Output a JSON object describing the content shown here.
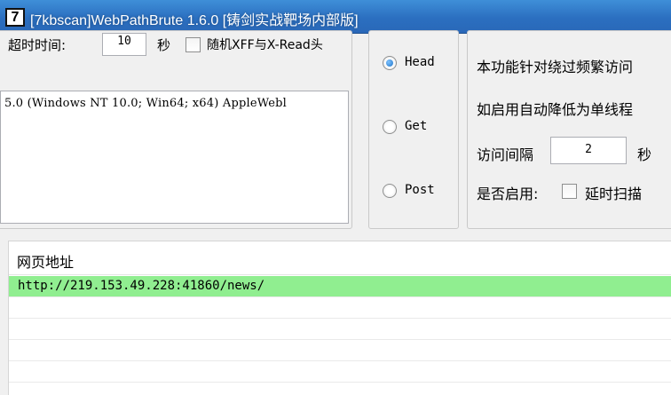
{
  "window": {
    "icon_text": "7",
    "title": "[7kbscan]WebPathBrute 1.6.0 [铸剑实战靶场内部版]"
  },
  "settings": {
    "timeout_label": "超时时间:",
    "timeout_value": "10",
    "timeout_unit": "秒",
    "random_xff_label": "随机XFF与X-Read头",
    "user_agent": "5.0 (Windows NT 10.0; Win64; x64) AppleWebl"
  },
  "method": {
    "options": [
      "Head",
      "Get",
      "Post"
    ],
    "selected": "Head"
  },
  "throttle": {
    "line1": "本功能针对绕过频繁访问",
    "line2": "如启用自动降低为单线程",
    "interval_label": "访问间隔",
    "interval_value": "2",
    "interval_unit": "秒",
    "enable_label": "是否启用:",
    "delay_scan_label": "延时扫描"
  },
  "results": {
    "column_header": "网页地址",
    "rows": [
      "http://219.153.49.228:41860/news/"
    ]
  },
  "colors": {
    "title_bar": "#2b6fc0",
    "selected_row": "#90ee90"
  }
}
